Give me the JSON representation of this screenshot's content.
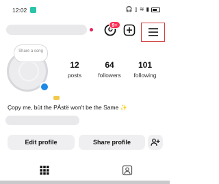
{
  "status_bar": {
    "time": "12:02",
    "icons": [
      "app-notification-icon",
      "headphones-icon",
      "vibrate-icon",
      "wifi-icon",
      "signal-icon",
      "battery-icon"
    ]
  },
  "header": {
    "threads_badge": "9+",
    "icons": [
      "threads-icon",
      "new-post-icon",
      "menu-icon"
    ]
  },
  "profile": {
    "note_text": "Share a song",
    "stats": [
      {
        "value": "12",
        "label": "posts"
      },
      {
        "value": "64",
        "label": "followers"
      },
      {
        "value": "101",
        "label": "following"
      }
    ],
    "bio": "Çopy me, bùt the PÂstë won't be the Same ✨"
  },
  "actions": {
    "edit_profile": "Edit profile",
    "share_profile": "Share profile",
    "add_person_icon": "add-person-icon"
  },
  "tabs": [
    {
      "name": "grid",
      "icon": "grid-icon",
      "active": true
    },
    {
      "name": "tagged",
      "icon": "tagged-icon",
      "active": false
    }
  ],
  "colors": {
    "badge": "#ff2d55",
    "highlight_box": "#d23b3b",
    "story_add": "#1e88e5"
  }
}
